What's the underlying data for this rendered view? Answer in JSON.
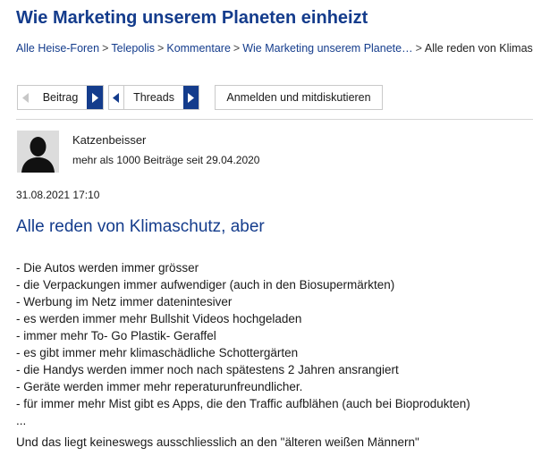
{
  "thread": {
    "title": "Wie Marketing unserem Planeten einheizt"
  },
  "breadcrumb": [
    "Alle Heise-Foren",
    "Telepolis",
    "Kommentare",
    "Wie Marketing unserem Planete…",
    "Alle reden von Klimaschu"
  ],
  "nav": {
    "beitrag_label": "Beitrag",
    "threads_label": "Threads",
    "login_label": "Anmelden und mitdiskutieren"
  },
  "author": {
    "name": "Katzenbeisser",
    "meta": "mehr als 1000 Beiträge seit 29.04.2020"
  },
  "post": {
    "date": "31.08.2021 17:10",
    "title": "Alle reden von Klimaschutz, aber",
    "lines": [
      "- Die Autos werden immer grösser",
      "- die Verpackungen immer aufwendiger (auch in den Biosupermärkten)",
      "- Werbung im Netz immer datenintesiver",
      "- es werden immer mehr Bullshit Videos hochgeladen",
      "- immer mehr To- Go Plastik- Geraffel",
      "- es gibt immer mehr klimaschädliche Schottergärten",
      "- die Handys werden immer noch nach spätestens 2 Jahren ansrangiert",
      "- Geräte werden immer mehr reperaturunfreundlicher.",
      "- für immer mehr Mist gibt es Apps, die den Traffic aufblähen (auch bei Bioprodukten)",
      "..."
    ],
    "footer": "Und das liegt keineswegs ausschliesslich an den \"älteren weißen Männern\""
  },
  "colors": {
    "link": "#143c8c",
    "nav_active": "#143c8c",
    "border": "#c9c9c9"
  },
  "icons": [
    "chevron-left-icon",
    "chevron-right-icon",
    "avatar-silhouette"
  ]
}
